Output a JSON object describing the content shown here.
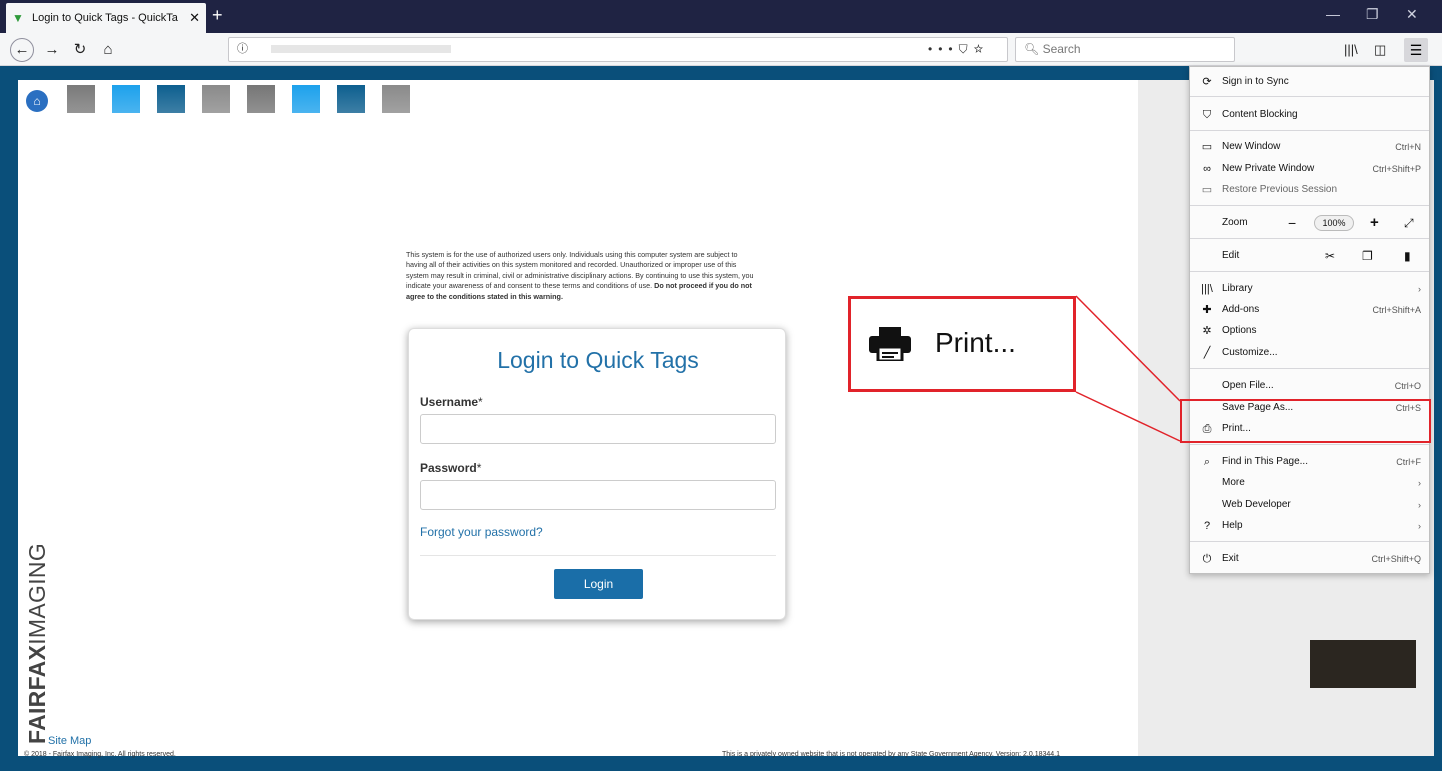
{
  "browser": {
    "tab_title": "Login to Quick Tags - QuickTa",
    "tab_close": "✕",
    "new_tab": "+",
    "url_prefix": "ⓘ",
    "search_placeholder": "Search",
    "window_controls": [
      "—",
      "❐",
      "✕"
    ]
  },
  "page": {
    "warning_text": "This system is for the use of authorized users only. Individuals using this computer system are subject to having all of their activities on this system monitored and recorded. Unauthorized or improper use of this system may result in criminal, civil or administrative disciplinary actions. By continuing to use this system, you indicate your awareness of and consent to these terms and conditions of use.",
    "warning_bold": "Do not proceed if you do not agree to the conditions stated in this warning.",
    "login_title": "Login to Quick Tags",
    "username_label": "Username",
    "password_label": "Password",
    "required_mark": "*",
    "forgot_link": "Forgot your password?",
    "login_button": "Login",
    "brand_bold": "FAIRFAX",
    "brand_light": "IMAGING",
    "site_map": "Site Map",
    "copyright": "© 2018 - Fairfax Imaging, Inc. All rights reserved.",
    "disclaimer": "This is a privately owned website that is not operated by any State Government Agency. Version: 2.0.18344.1",
    "tile_colors": [
      "#7a7a7a",
      "#1da1ec",
      "#0d5f8f",
      "#8a8a8a",
      "#767676",
      "#1da1ec",
      "#0d5f8f",
      "#8a8a8a"
    ]
  },
  "menu": {
    "sign_in": "Sign in to Sync",
    "content_blocking": "Content Blocking",
    "new_window": "New Window",
    "new_window_sc": "Ctrl+N",
    "new_private": "New Private Window",
    "new_private_sc": "Ctrl+Shift+P",
    "restore": "Restore Previous Session",
    "zoom": "Zoom",
    "zoom_minus": "−",
    "zoom_level": "100%",
    "zoom_plus": "+",
    "edit": "Edit",
    "library": "Library",
    "addons": "Add-ons",
    "addons_sc": "Ctrl+Shift+A",
    "options": "Options",
    "customize": "Customize...",
    "open_file": "Open File...",
    "open_file_sc": "Ctrl+O",
    "save_page": "Save Page As...",
    "save_page_sc": "Ctrl+S",
    "print": "Print...",
    "find": "Find in This Page...",
    "find_sc": "Ctrl+F",
    "more": "More",
    "web_dev": "Web Developer",
    "help": "Help",
    "exit": "Exit",
    "exit_sc": "Ctrl+Shift+Q",
    "arrow": "›"
  },
  "callout": {
    "label": "Print...",
    "color": "#e1232a"
  }
}
